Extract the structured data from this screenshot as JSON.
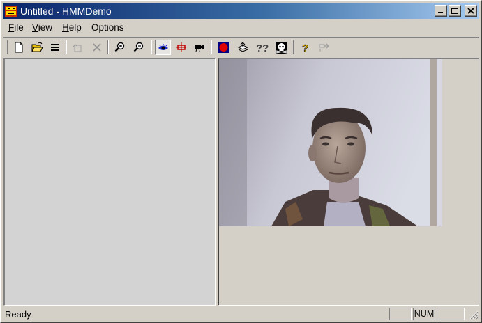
{
  "window": {
    "title": "Untitled - HMMDemo",
    "icon": "hmmdemo-app-icon"
  },
  "menu": {
    "items": [
      {
        "label": "File",
        "accel": "F"
      },
      {
        "label": "View",
        "accel": "V"
      },
      {
        "label": "Help",
        "accel": "H"
      },
      {
        "label": "Options",
        "accel": ""
      }
    ]
  },
  "toolbar": {
    "buttons": [
      {
        "name": "new-file-icon",
        "enabled": true
      },
      {
        "name": "open-folder-icon",
        "enabled": true
      },
      {
        "name": "list-icon",
        "enabled": true
      },
      {
        "name": "add-to-base-icon",
        "enabled": false
      },
      {
        "name": "delete-icon",
        "enabled": false
      },
      {
        "name": "zoom-in-icon",
        "enabled": true
      },
      {
        "name": "zoom-out-icon",
        "enabled": true
      },
      {
        "name": "eye-icon",
        "enabled": true,
        "pressed": true
      },
      {
        "name": "capture-frame-icon",
        "enabled": true
      },
      {
        "name": "camera-icon",
        "enabled": true
      },
      {
        "name": "record-icon",
        "enabled": true
      },
      {
        "name": "layers-icon",
        "enabled": true
      },
      {
        "name": "recognize-icon",
        "enabled": true
      },
      {
        "name": "skull-icon",
        "enabled": true
      },
      {
        "name": "help-icon",
        "enabled": true
      },
      {
        "name": "context-help-icon",
        "enabled": false
      }
    ]
  },
  "status": {
    "text": "Ready",
    "indicators": [
      "",
      "NUM",
      ""
    ]
  },
  "colors": {
    "titlebar_start": "#0a246a",
    "titlebar_end": "#a6caf0",
    "face": "#d4d0c8",
    "left_pane": "#d3d3d3"
  }
}
